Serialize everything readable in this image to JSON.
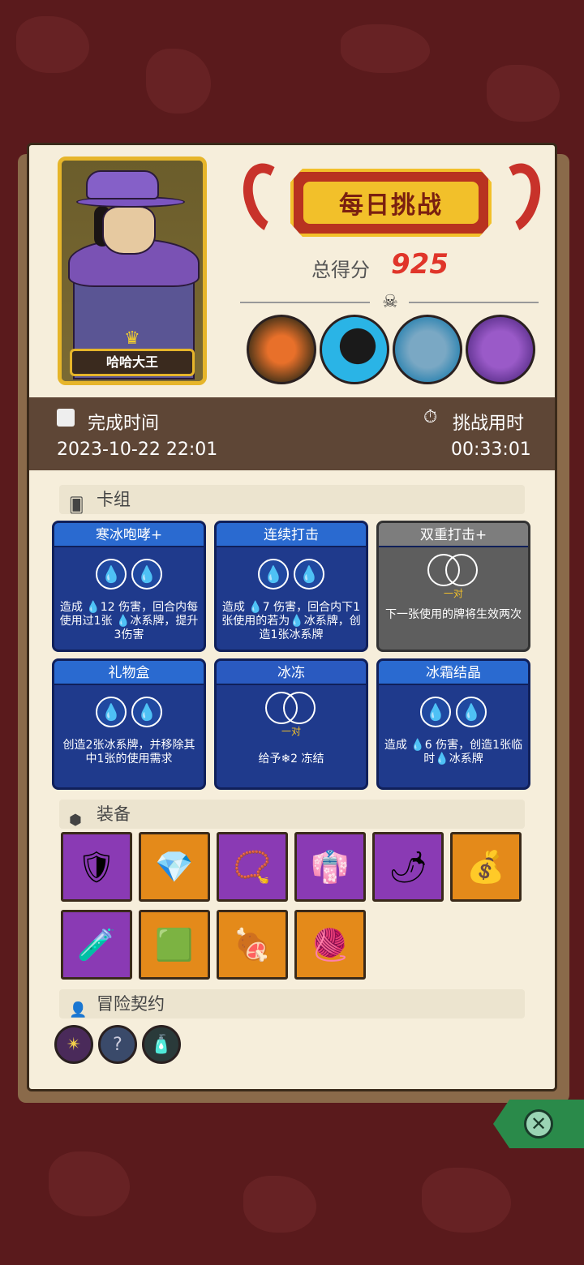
{
  "header": {
    "character_name": "哈哈大王",
    "banner_title": "每日挑战",
    "score_label": "总得分",
    "score_value": "925"
  },
  "bosses": [
    "boss-eye-icon",
    "boss-shadow-icon",
    "boss-fish-icon",
    "boss-dragon-icon"
  ],
  "timebar": {
    "finish_label": "完成时间",
    "finish_value": "2023-10-22 22:01",
    "duration_label": "挑战用时",
    "duration_value": "00:33:01"
  },
  "deck": {
    "section_label": "卡组",
    "cards": [
      {
        "title": "寒冰咆哮+",
        "type": "blue",
        "desc": "造成 💧12 伤害，回合内每使用过1张 💧冰系牌，提升3伤害"
      },
      {
        "title": "连续打击",
        "type": "blue",
        "desc": "造成 💧7 伤害，回合内下1张使用的若为💧冰系牌，创造1张冰系牌"
      },
      {
        "title": "双重打击+",
        "type": "gray",
        "pair_label": "一对",
        "desc": "下一张使用的牌将生效两次"
      },
      {
        "title": "礼物盒",
        "type": "blue",
        "desc": "创造2张冰系牌，并移除其中1张的使用需求"
      },
      {
        "title": "冰冻",
        "type": "pair",
        "pair_label": "一对",
        "desc": "给予❄2 冻结"
      },
      {
        "title": "冰霜结晶",
        "type": "blue",
        "desc": "造成 💧6 伤害，创造1张临时💧冰系牌"
      }
    ]
  },
  "equipment": {
    "section_label": "装备",
    "items": [
      {
        "icon": "flame-shield-icon",
        "glyph": "🛡",
        "color": "purple"
      },
      {
        "icon": "crystal-icon",
        "glyph": "💎",
        "color": "orange"
      },
      {
        "icon": "amulet-icon",
        "glyph": "📿",
        "color": "purple"
      },
      {
        "icon": "robe-icon",
        "glyph": "👘",
        "color": "purple"
      },
      {
        "icon": "chili-icon",
        "glyph": "🌶",
        "color": "purple"
      },
      {
        "icon": "bag-icon",
        "glyph": "💰",
        "color": "orange"
      },
      {
        "icon": "potion-icon",
        "glyph": "🧪",
        "color": "purple"
      },
      {
        "icon": "moss-block-icon",
        "glyph": "🟩",
        "color": "orange"
      },
      {
        "icon": "meat-plate-icon",
        "glyph": "🍖",
        "color": "orange"
      },
      {
        "icon": "sweater-icon",
        "glyph": "🧶",
        "color": "orange"
      }
    ]
  },
  "contracts": {
    "section_label": "冒险契约",
    "items": [
      {
        "icon": "dark-sigil-icon",
        "glyph": "✴"
      },
      {
        "icon": "question-shield-icon",
        "glyph": "?"
      },
      {
        "icon": "bottle-icon",
        "glyph": "🧴"
      }
    ]
  }
}
